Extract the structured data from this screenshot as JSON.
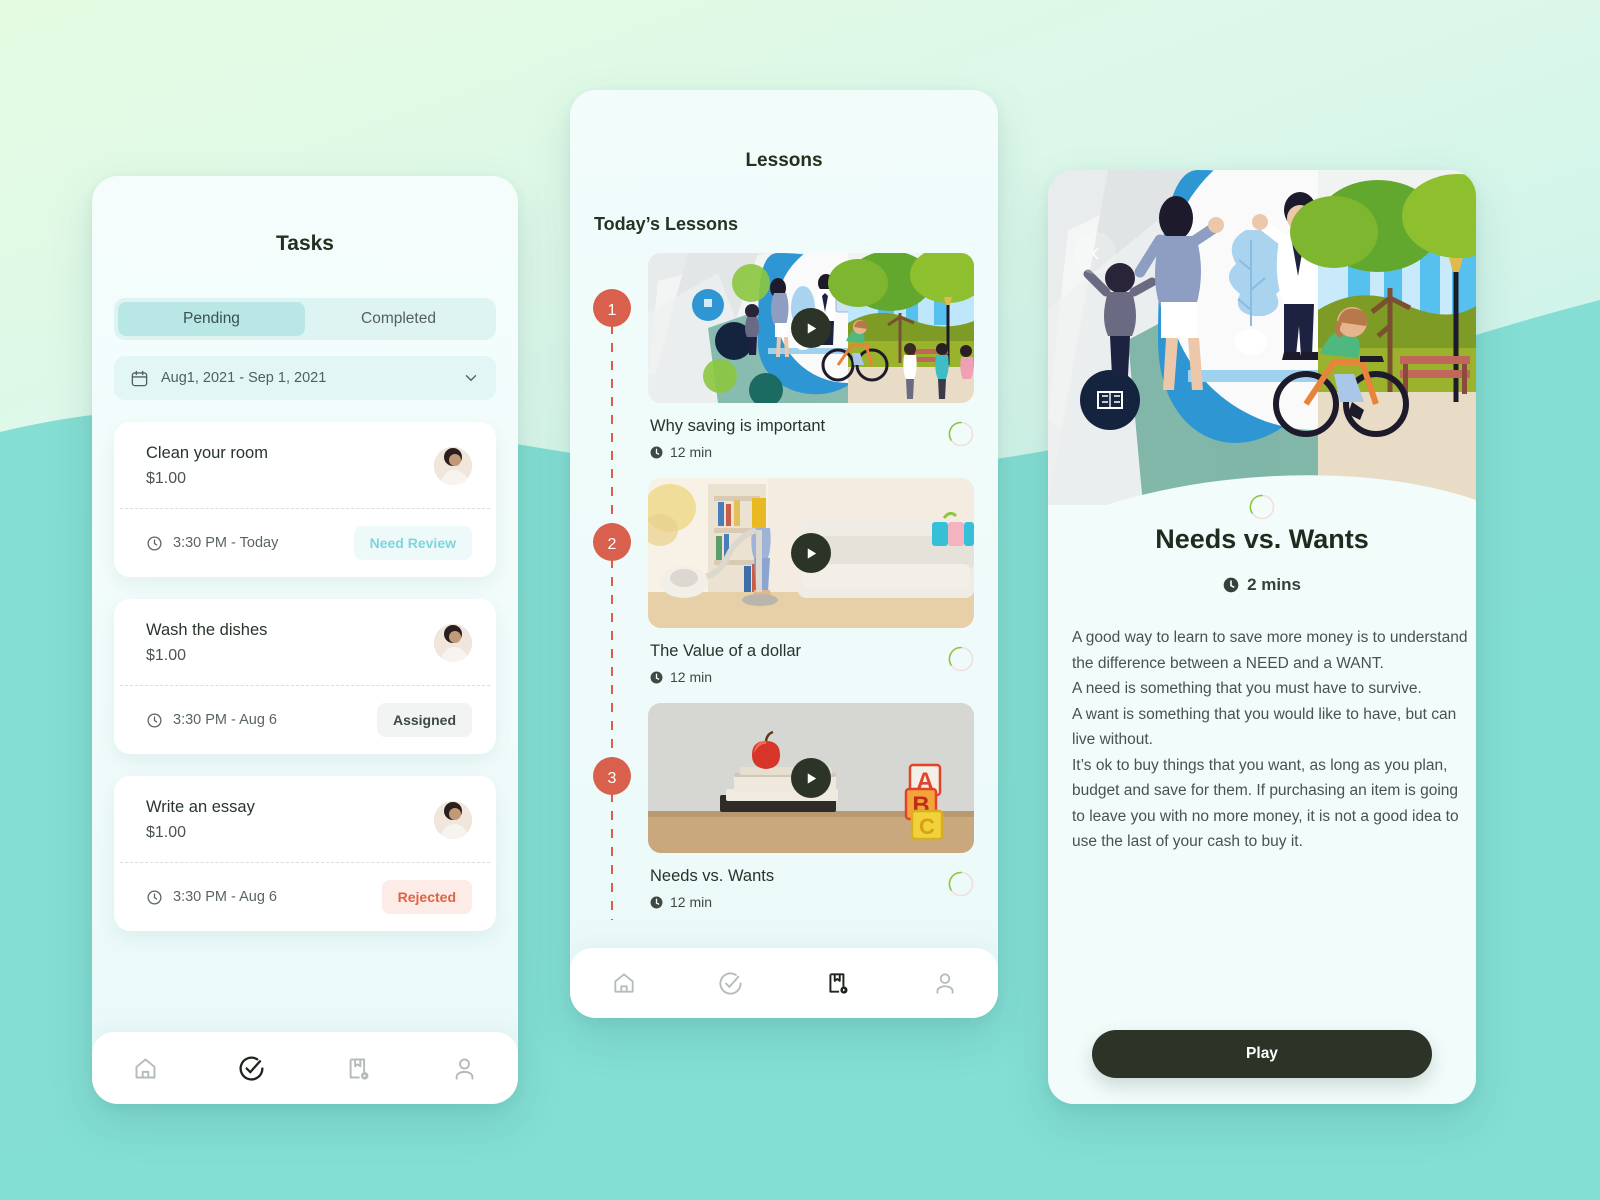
{
  "theme": {
    "bg_top": "#e4fbe2",
    "bg_bottom": "#bdeee8",
    "wave": "#7fdcd2",
    "accent_teal": "#7fd4dd",
    "accent_coral": "#d9604c",
    "dark": "#2c3327"
  },
  "tasks_screen": {
    "title": "Tasks",
    "tabs": [
      {
        "label": "Pending",
        "active": true
      },
      {
        "label": "Completed",
        "active": false
      }
    ],
    "date_filter": {
      "icon": "calendar-icon",
      "value": "Aug1, 2021 - Sep 1, 2021",
      "chevron": "chevron-down-icon"
    },
    "tasks": [
      {
        "name": "Clean your room",
        "price": "$1.00",
        "time": "3:30 PM - Today",
        "status": "Need Review",
        "status_kind": "review"
      },
      {
        "name": "Wash the dishes",
        "price": "$1.00",
        "time": "3:30 PM - Aug 6",
        "status": "Assigned",
        "status_kind": "assigned"
      },
      {
        "name": "Write an essay",
        "price": "$1.00",
        "time": "3:30 PM - Aug 6",
        "status": "Rejected",
        "status_kind": "rejected"
      }
    ],
    "tabbar": [
      {
        "icon": "home-icon",
        "active": false
      },
      {
        "icon": "tasks-check-icon",
        "active": true
      },
      {
        "icon": "lessons-play-icon",
        "active": false
      },
      {
        "icon": "profile-icon",
        "active": false
      }
    ]
  },
  "lessons_screen": {
    "title": "Lessons",
    "section_title": "Today’s Lessons",
    "lessons": [
      {
        "step": "1",
        "title": "Why saving is important",
        "duration": "12 min",
        "thumb": "city-park-illustration",
        "clock_icon": "clock-icon",
        "ring": "progress-ring"
      },
      {
        "step": "2",
        "title": "The Value of a dollar",
        "duration": "12 min",
        "thumb": "vacuuming-living-room-photo",
        "clock_icon": "clock-icon",
        "ring": "progress-ring"
      },
      {
        "step": "3",
        "title": "Needs vs. Wants",
        "duration": "12 min",
        "thumb": "apple-books-abc-blocks-photo",
        "clock_icon": "clock-icon",
        "ring": "progress-ring"
      }
    ],
    "tabbar": [
      {
        "icon": "home-icon",
        "active": false
      },
      {
        "icon": "tasks-check-icon",
        "active": false
      },
      {
        "icon": "lessons-play-icon",
        "active": true
      },
      {
        "icon": "profile-icon",
        "active": false
      }
    ]
  },
  "detail_screen": {
    "back_icon": "chevron-left-icon",
    "hero": "city-park-family-illustration",
    "ring": "progress-ring",
    "title": "Needs vs. Wants",
    "clock_icon": "clock-icon",
    "duration": "2 mins",
    "body": "A good way to learn to save more money is to understand the difference between a NEED and a WANT.\nA need is something that you must have to survive.\nA want is something that you would like to have, but can live without.\nIt’s ok to buy things that you want, as long as you plan, budget and save for them. If purchasing an item is going to leave you with no more money, it is not a good idea to use the last of your cash to buy it.",
    "play_label": "Play"
  }
}
